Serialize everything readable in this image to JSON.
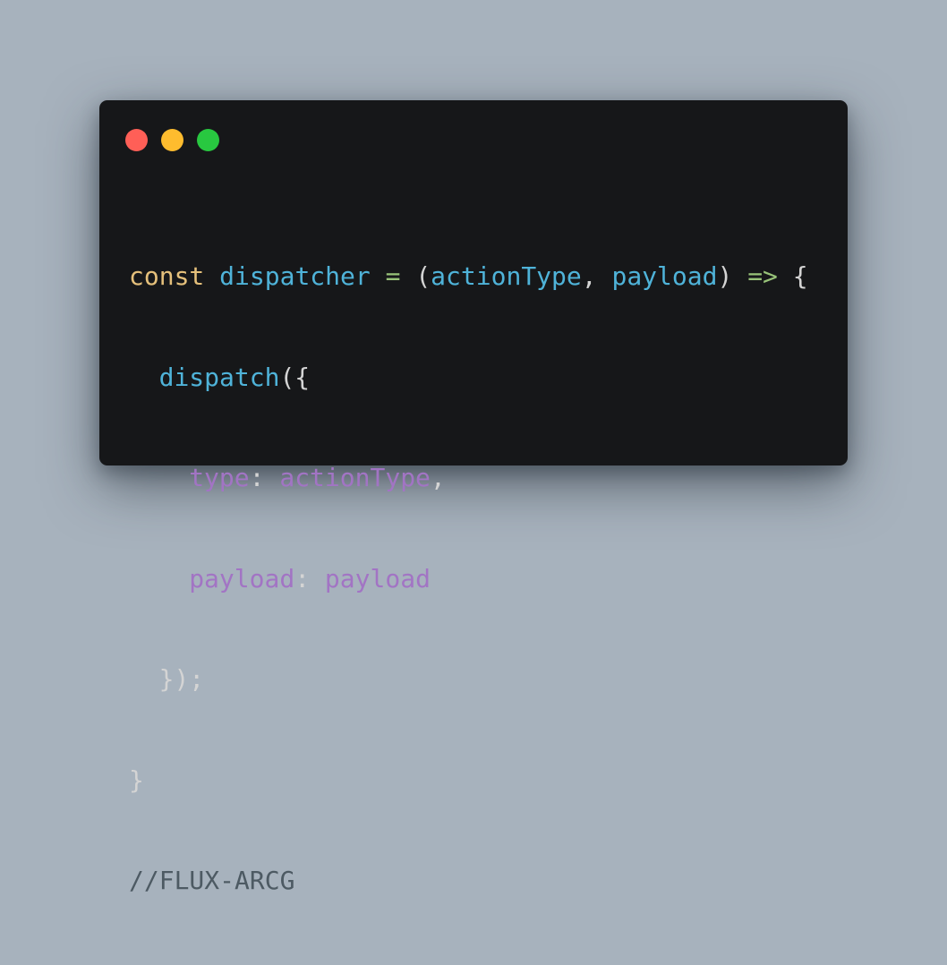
{
  "window": {
    "colors": {
      "background": "#161719",
      "page_background": "#a7b2bd",
      "close": "#ff5f57",
      "minimize": "#febc2e",
      "zoom": "#28c840"
    }
  },
  "traffic_lights": {
    "close": "close-dot",
    "minimize": "minimize-dot",
    "zoom": "zoom-dot"
  },
  "syntax_colors": {
    "keyword": "#e5c07b",
    "identifier": "#4fb3d9",
    "operator": "#98c379",
    "property": "#a274c4",
    "punctuation": "#d4d4d4",
    "comment": "#4d5a63"
  },
  "code": {
    "line1": {
      "keyword": "const",
      "name": "dispatcher",
      "assign": "=",
      "open_paren": "(",
      "param1": "actionType",
      "comma": ",",
      "param2": "payload",
      "close_paren": ")",
      "arrow": "=>",
      "open_brace": "{"
    },
    "line2": {
      "call": "dispatch",
      "open": "({"
    },
    "line3": {
      "key": "type",
      "colon": ":",
      "value": "actionType",
      "comma": ","
    },
    "line4": {
      "key": "payload",
      "colon": ":",
      "value": "payload"
    },
    "line5": {
      "close": "});"
    },
    "line6": {
      "close": "}"
    },
    "line7": {
      "comment": "//FLUX-ARCG"
    }
  }
}
